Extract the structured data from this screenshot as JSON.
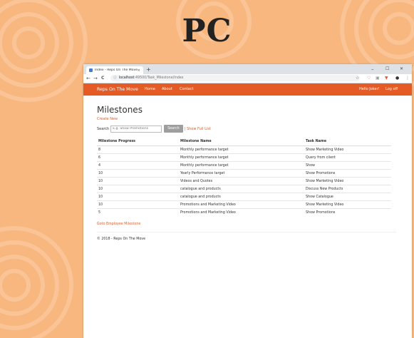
{
  "hero": {
    "title": "PC"
  },
  "browser": {
    "tab_title": "Index - Reps On The Move",
    "tab_close": "×",
    "new_tab": "+",
    "minimize": "–",
    "maximize": "☐",
    "close": "✕",
    "back": "←",
    "forward": "→",
    "reload": "C",
    "info_icon": "ⓘ",
    "url_host": "localhost",
    "url_path": ":49500/Task_Milestone/Index",
    "star": "☆",
    "menu": "⋮"
  },
  "navbar": {
    "brand": "Reps On The Move",
    "links": [
      "Home",
      "About",
      "Contact"
    ],
    "greeting": "Hello Joker!",
    "logoff": "Log off"
  },
  "page": {
    "title": "Milestones",
    "create_new": "Create New",
    "search_label": "Search",
    "search_placeholder": "E.g. Show Promotions",
    "search_button": "Search",
    "show_full": "| Show Full List",
    "goto": "Goto Employee Milestone",
    "footer": "© 2018 - Reps On The Move"
  },
  "table": {
    "headers": [
      "Milestone Progress",
      "Milestone Name",
      "Task Name"
    ],
    "rows": [
      [
        "8",
        "Monthly performance target",
        "Show Marketing Video"
      ],
      [
        "6",
        "Monthly performance target",
        "Query from client"
      ],
      [
        "4",
        "Monthly performance target",
        "Show"
      ],
      [
        "10",
        "Yearly Performance target",
        "Show Promotions"
      ],
      [
        "10",
        "Videos and Quotes",
        "Show Marketing Video"
      ],
      [
        "10",
        "catalogue and products",
        "Discuss New Products"
      ],
      [
        "10",
        "catalogue and products",
        "Show Catalogue"
      ],
      [
        "10",
        "Promotions and Marketing Video",
        "Show Marketing Video"
      ],
      [
        "5",
        "Promotions and Marketing Video",
        "Show Promotions"
      ]
    ]
  },
  "colors": {
    "accent": "#e45b25",
    "background": "#f7b77e",
    "button": "#9e9e9e"
  }
}
